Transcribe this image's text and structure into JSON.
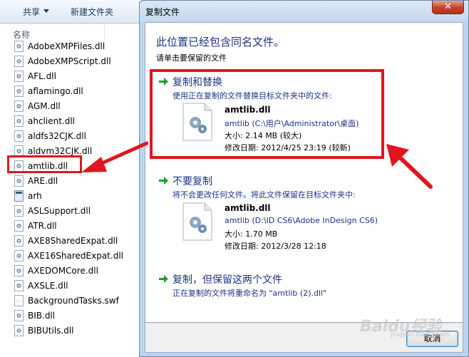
{
  "explorer": {
    "toolbar": {
      "share_label": "共享",
      "new_folder_label": "新建文件夹"
    },
    "column_header": "名称",
    "files": [
      {
        "name": "AdobeXMPFiles.dll",
        "icon": "dll-file-icon"
      },
      {
        "name": "AdobeXMPScript.dll",
        "icon": "dll-file-icon"
      },
      {
        "name": "AFL.dll",
        "icon": "dll-file-icon"
      },
      {
        "name": "aflamingo.dll",
        "icon": "dll-file-icon"
      },
      {
        "name": "AGM.dll",
        "icon": "dll-file-icon"
      },
      {
        "name": "ahclient.dll",
        "icon": "dll-file-icon"
      },
      {
        "name": "aldfs32CJK.dll",
        "icon": "dll-file-icon"
      },
      {
        "name": "aldvm32CJK.dll",
        "icon": "dll-file-icon"
      },
      {
        "name": "amtlib.dll",
        "icon": "dll-file-icon"
      },
      {
        "name": "ARE.dll",
        "icon": "dll-file-icon"
      },
      {
        "name": "arh",
        "icon": "app-file-icon"
      },
      {
        "name": "ASLSupport.dll",
        "icon": "dll-file-icon"
      },
      {
        "name": "ATR.dll",
        "icon": "dll-file-icon"
      },
      {
        "name": "AXE8SharedExpat.dll",
        "icon": "dll-file-icon"
      },
      {
        "name": "AXE16SharedExpat.dll",
        "icon": "dll-file-icon"
      },
      {
        "name": "AXEDOMCore.dll",
        "icon": "dll-file-icon"
      },
      {
        "name": "AXSLE.dll",
        "icon": "dll-file-icon"
      },
      {
        "name": "BackgroundTasks.swf",
        "icon": "plain-file-icon"
      },
      {
        "name": "BIB.dll",
        "icon": "dll-file-icon"
      },
      {
        "name": "BIBUtils.dll",
        "icon": "dll-file-icon"
      }
    ]
  },
  "dialog": {
    "title": "复制文件",
    "close_label": "✕",
    "heading": "此位置已经包含同名文件。",
    "subheading": "请单击要保留的文件",
    "options": {
      "replace": {
        "title": "复制和替换",
        "description": "使用正在复制的文件替换目标文件夹中的文件:",
        "file_name": "amtlib.dll",
        "path": "amtlib (C:\\用户\\Administrator\\桌面)",
        "size": "大小: 2.14 MB (较大)",
        "modified": "修改日期: 2012/4/25 23:19 (较新)"
      },
      "skip": {
        "title": "不要复制",
        "description": "将不会更改任何文件。将此文件保留在目标文件夹中:",
        "file_name": "amtlib.dll",
        "path": "amtlib (D:\\ID CS6\\Adobe InDesign CS6)",
        "size": "大小: 1.70 MB",
        "modified": "修改日期: 2012/3/28 12:18"
      },
      "keep_both": {
        "title": "复制，但保留这两个文件",
        "description": "正在复制的文件将重命名为 \"amtlib (2).dll\""
      }
    },
    "cancel_label": "取消"
  },
  "watermark": {
    "text": "Baidu经验",
    "sub": "jingyan.baidu.com"
  },
  "colors": {
    "annotation_red": "#e0161e",
    "link_blue": "#1e3287",
    "arrow_green": "#1f9e2a"
  }
}
